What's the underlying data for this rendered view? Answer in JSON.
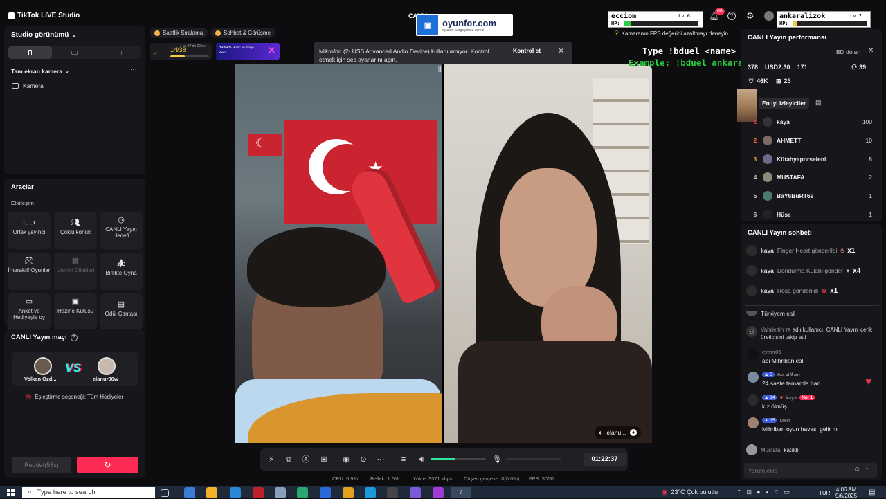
{
  "app": {
    "title": "TikTok LIVE Studio",
    "center_title": "CANLI"
  },
  "ad_banner": {
    "brand": "oyunfor.com",
    "tagline": "oyunun vazgeçilmez adresi",
    "badge": "points"
  },
  "overlay": {
    "left_player": {
      "name": "ecciom",
      "level": "Lv.6",
      "hp_label": "HP:"
    },
    "right_player": {
      "name": "ankaralizok",
      "level": "Lv.2",
      "hp_label": "HP:"
    },
    "command_line": "Type !bduel <name> to play",
    "example_line": "Example: !bduel ankaralizoktay"
  },
  "header": {
    "notification_count": "68",
    "fps_tip": "Kameranın FPS değerini azaltmayı deneyin"
  },
  "left_panel": {
    "studio_view": "Studio görünümü",
    "source_section": "Tam ekran kamera",
    "camera_source": "Kamera",
    "tools_title": "Araçlar",
    "interaction_label": "Etkileşim",
    "tools": [
      {
        "icon": "link-icon",
        "label": "Ortak yayıncı"
      },
      {
        "icon": "users-icon",
        "label": "Çoklu konuk"
      },
      {
        "icon": "target-icon",
        "label": "CANLI Yayın Hedefi"
      },
      {
        "icon": "gamepad-icon",
        "label": "İnteraktif Oyunlar"
      },
      {
        "icon": "gift-grid-icon",
        "label": "İzleyici Dilekleri"
      },
      {
        "icon": "play-together-icon",
        "label": "Birlikte Oyna"
      },
      {
        "icon": "poll-icon",
        "label": "Anket ve Hediyeyle oy"
      },
      {
        "icon": "treasure-icon",
        "label": "Hazine Kutusu"
      },
      {
        "icon": "reward-bag-icon",
        "label": "Ödül Çantası"
      }
    ],
    "match_title": "CANLI Yayın maçı",
    "match": {
      "player1": "Volkan Özd...",
      "player2": "elanur06w",
      "vs": "VS",
      "option": "Eşleştirme seçeneği: Tüm Hediyeler"
    },
    "reject_button": "Reddet(58s)"
  },
  "top_chips": {
    "ranking": "Saatlik Sıralama",
    "chat": "Sohbet & Görüşme",
    "progress_value": "14/38",
    "progress_time": "1 sa 37 dk 29 sn",
    "progress_fraction": 0.37,
    "promo_title": "TikTok'ta Music on Stage 2024"
  },
  "toast": {
    "message": "Mikrofon (2- USB Advanced Audio Device) kullanılamıyor. Kontrol etmek için ses ayarlarını açın.",
    "action": "Kontrol et"
  },
  "video": {
    "guest_name": "elanu...",
    "timer": "01:22:37",
    "volume_fraction": 0.45
  },
  "stats": {
    "cpu": "CPU: 5.9%",
    "memory": "Bellek: 1.6%",
    "upload": "Yükle: 3371 kbps",
    "dropped": "Düşen çerçeve: 0(0.0%)",
    "fps": "FPS: 30/30"
  },
  "right_panel": {
    "performance_title": "CANLI Yayın performansı",
    "perf_partial": "BD doları",
    "metrics": {
      "viewers": "378",
      "diamonds": "USD2.30",
      "new": "171",
      "shares": "39",
      "likes": "46K",
      "gifters": "25"
    },
    "top_viewers_title": "En iyi izleyiciler",
    "top_viewers": [
      {
        "rank": "1",
        "name": "kaya",
        "score": "100"
      },
      {
        "rank": "2",
        "name": "AHMETT",
        "score": "10"
      },
      {
        "rank": "3",
        "name": "Kütahyaporseleni",
        "score": "8"
      },
      {
        "rank": "4",
        "name": "MUSTAFA",
        "score": "2"
      },
      {
        "rank": "5",
        "name": "BaY6BuRT69",
        "score": "1"
      },
      {
        "rank": "6",
        "name": "Hüse",
        "score": "1"
      }
    ],
    "chat_title": "CANLI Yayın sohbeti",
    "gifts": [
      {
        "user": "kaya",
        "text": "Finger Heart gönderildi",
        "count": "x1"
      },
      {
        "user": "kaya",
        "text": "Dondurma Külahı gönder",
        "count": "x4"
      },
      {
        "user": "kaya",
        "text": "Rosa gönderildi",
        "count": "x1"
      }
    ],
    "messages": [
      {
        "user": "",
        "text": "Türkiyem call"
      },
      {
        "user": "Vahdettin ᴛʀ",
        "text": "adlı kullanıcı, CANLI Yayın içerik üreticisini takip etti"
      },
      {
        "user": "eymrr06",
        "text": "abi Mihriban call"
      },
      {
        "user": "Isa.Alkan",
        "badge": "5",
        "text": "24 saate tamamla bari"
      },
      {
        "user": "kaya",
        "badge": "14",
        "extra": "No. 1",
        "text": "kız ölmüş"
      },
      {
        "user": "Mert",
        "badge": "15",
        "text": "Mihriban oyun havası gelir mi"
      },
      {
        "user": "Mustafa",
        "text": "katıldı"
      }
    ],
    "comment_placeholder": "Yorum ekle"
  },
  "taskbar": {
    "search_placeholder": "Type here to search",
    "weather": "23°C  Çok bulutlu",
    "lang": "TUR",
    "time": "4:06 AM",
    "date": "9/6/2025"
  },
  "colors": {
    "accent": "#fe2c55",
    "teal": "#25f4ee",
    "overlay_green": "#2ecc40"
  }
}
